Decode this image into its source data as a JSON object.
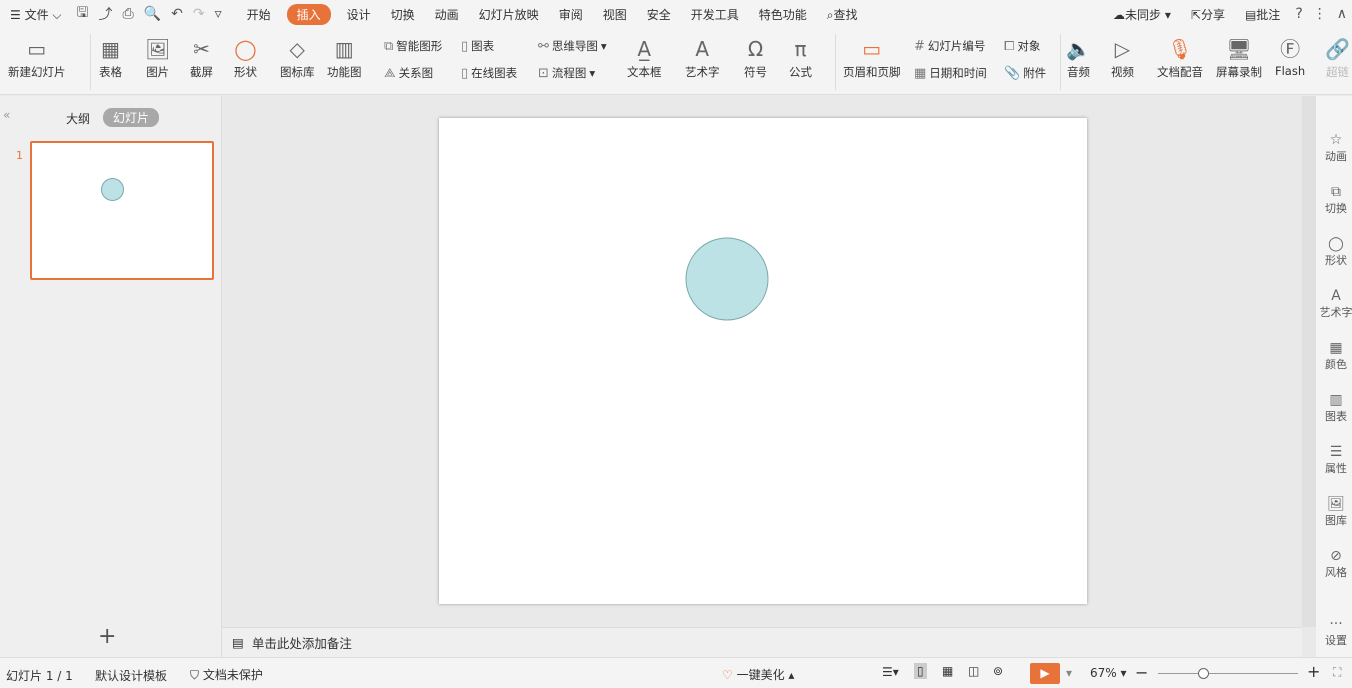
{
  "menu": {
    "file": "文件",
    "tabs": [
      "开始",
      "插入",
      "设计",
      "切换",
      "动画",
      "幻灯片放映",
      "审阅",
      "视图",
      "安全",
      "开发工具",
      "特色功能"
    ],
    "active_tab": "插入",
    "search": "查找",
    "sync": "未同步",
    "share": "分享",
    "comment": "批注"
  },
  "ribbon": {
    "new_slide": "新建幻灯片",
    "table": "表格",
    "picture": "图片",
    "screenshot": "截屏",
    "shape": "形状",
    "icon_lib": "图标库",
    "func_chart": "功能图",
    "smart_art": "智能图形",
    "chart": "图表",
    "relation": "关系图",
    "online_chart": "在线图表",
    "mindmap": "思维导图",
    "flowchart": "流程图",
    "textbox": "文本框",
    "wordart": "艺术字",
    "symbol": "符号",
    "formula": "公式",
    "header_footer": "页眉和页脚",
    "slide_number": "幻灯片编号",
    "object": "对象",
    "datetime": "日期和时间",
    "attachment": "附件",
    "audio": "音频",
    "video": "视频",
    "doc_voice": "文档配音",
    "screen_record": "屏幕录制",
    "flash": "Flash",
    "hyperlink": "超链"
  },
  "left_panel": {
    "tab_outline": "大纲",
    "tab_slides": "幻灯片",
    "slide_index": "1"
  },
  "notes": {
    "placeholder": "单击此处添加备注"
  },
  "right_sidebar": [
    "动画",
    "切换",
    "形状",
    "艺术字",
    "颜色",
    "图表",
    "属性",
    "图库",
    "风格",
    "设置"
  ],
  "status": {
    "slide_count": "幻灯片 1 / 1",
    "template": "默认设计模板",
    "protection": "文档未保护",
    "beautify": "一键美化",
    "zoom": "67%",
    "zoom_percent": 67
  },
  "colors": {
    "accent": "#e8733a",
    "circle_fill": "#bde2e5",
    "circle_stroke": "#7aa9ad"
  }
}
